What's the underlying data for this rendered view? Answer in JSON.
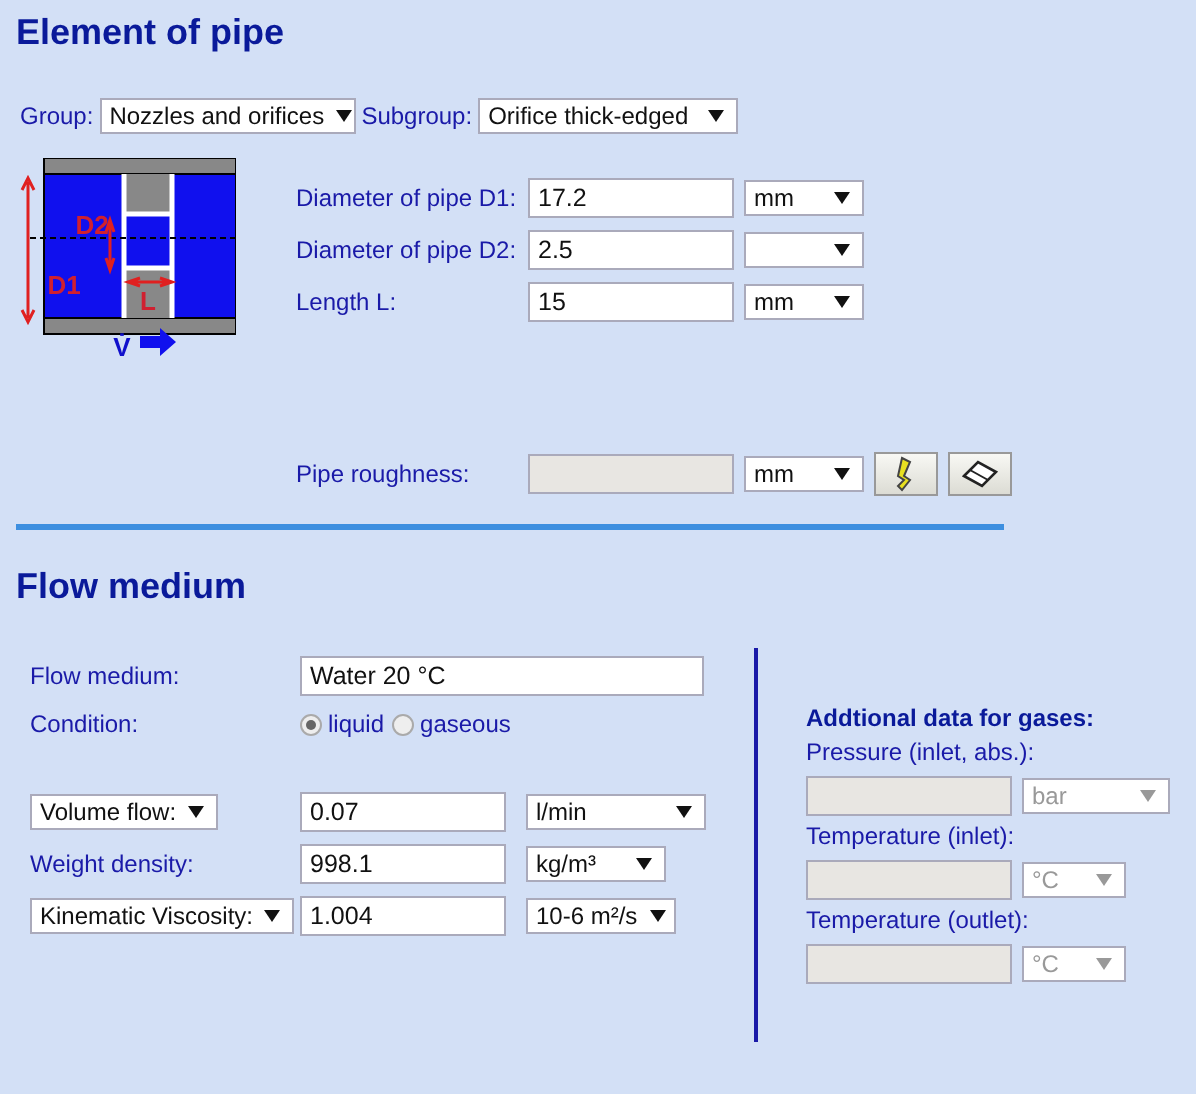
{
  "pipe": {
    "title": "Element of pipe",
    "group": {
      "label": "Group:",
      "value": "Nozzles and orifices"
    },
    "subgroup": {
      "label": "Subgroup:",
      "value": "Orifice thick-edged"
    },
    "diagram": {
      "d2_label": "D2",
      "d1_label": "D1",
      "length_label": "L",
      "flow_label": "V̇"
    },
    "fields": [
      {
        "label": "Diameter of pipe D1:",
        "value": "17.2",
        "unit": "mm"
      },
      {
        "label": "Diameter of pipe D2:",
        "value": "2.5"
      },
      {
        "label": "Length L:",
        "value": "15",
        "unit": "mm"
      }
    ],
    "roughness": {
      "label": "Pipe roughness:",
      "unit": "mm",
      "disabled": true
    }
  },
  "medium": {
    "title": "Flow medium",
    "name": {
      "label": "Flow medium:",
      "value": "Water 20 °C"
    },
    "condition": {
      "label": "Condition:",
      "options": [
        {
          "label": "liquid",
          "selected": true
        },
        {
          "label": "gaseous",
          "selected": false
        }
      ]
    },
    "rows": [
      {
        "kind": "select",
        "label": "Volume flow:",
        "value": "0.07",
        "unit": "l/min"
      },
      {
        "kind": "text",
        "label": "Weight density:",
        "value": "998.1",
        "unit": "kg/m³"
      },
      {
        "kind": "select",
        "label": "Kinematic Viscosity:",
        "value": "1.004",
        "unit": "10-6 m²/s"
      }
    ],
    "gases": {
      "title": "Addtional data for gases:",
      "fields": [
        {
          "label": "Pressure (inlet, abs.):",
          "unit": "bar",
          "disabled": true
        },
        {
          "label": "Temperature (inlet):",
          "unit": "°C",
          "disabled": true
        },
        {
          "label": "Temperature (outlet):",
          "unit": "°C",
          "disabled": true
        }
      ]
    }
  }
}
